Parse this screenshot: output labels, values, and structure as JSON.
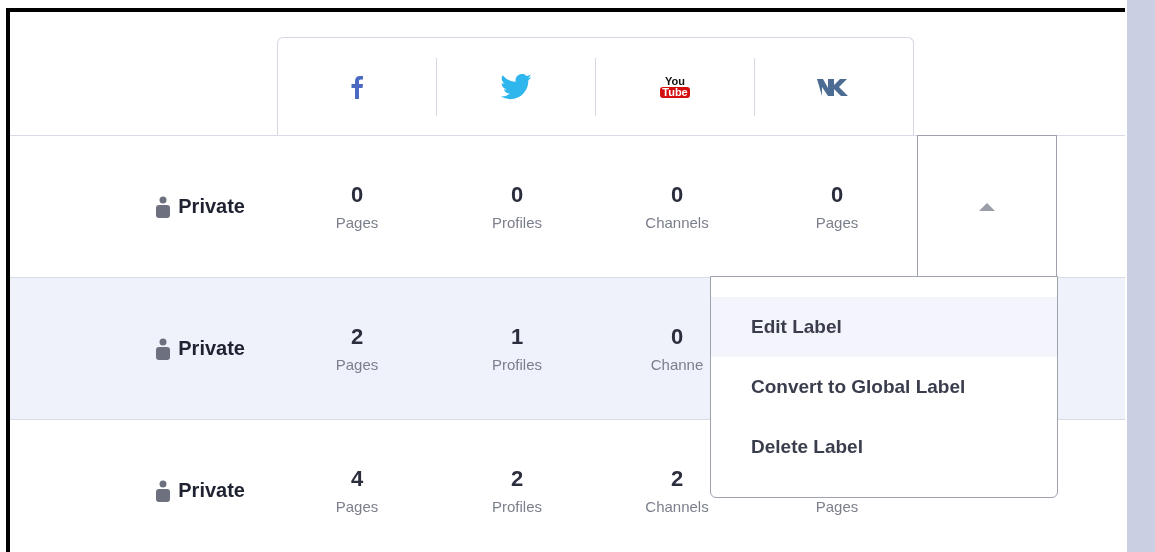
{
  "network_tabs": [
    {
      "kind": "facebook"
    },
    {
      "kind": "twitter"
    },
    {
      "kind": "youtube",
      "logo_top": "You",
      "logo_bottom": "Tube"
    },
    {
      "kind": "vk"
    }
  ],
  "rows": [
    {
      "selected": false,
      "visibility": "Private",
      "stats": [
        {
          "value": "0",
          "label": "Pages"
        },
        {
          "value": "0",
          "label": "Profiles"
        },
        {
          "value": "0",
          "label": "Channels"
        },
        {
          "value": "0",
          "label": "Pages"
        }
      ],
      "toggle": {
        "expanded": true
      }
    },
    {
      "selected": true,
      "visibility": "Private",
      "stats": [
        {
          "value": "2",
          "label": "Pages"
        },
        {
          "value": "1",
          "label": "Profiles"
        },
        {
          "value": "0",
          "label": "Channe"
        }
      ]
    },
    {
      "selected": false,
      "visibility": "Private",
      "stats": [
        {
          "value": "4",
          "label": "Pages"
        },
        {
          "value": "2",
          "label": "Profiles"
        },
        {
          "value": "2",
          "label": "Channels"
        },
        {
          "label": "Pages"
        }
      ]
    }
  ],
  "menu": [
    {
      "label": "Edit Label",
      "selected": true
    },
    {
      "label": "Convert to Global Label",
      "selected": false
    },
    {
      "label": "Delete Label",
      "selected": false
    }
  ]
}
